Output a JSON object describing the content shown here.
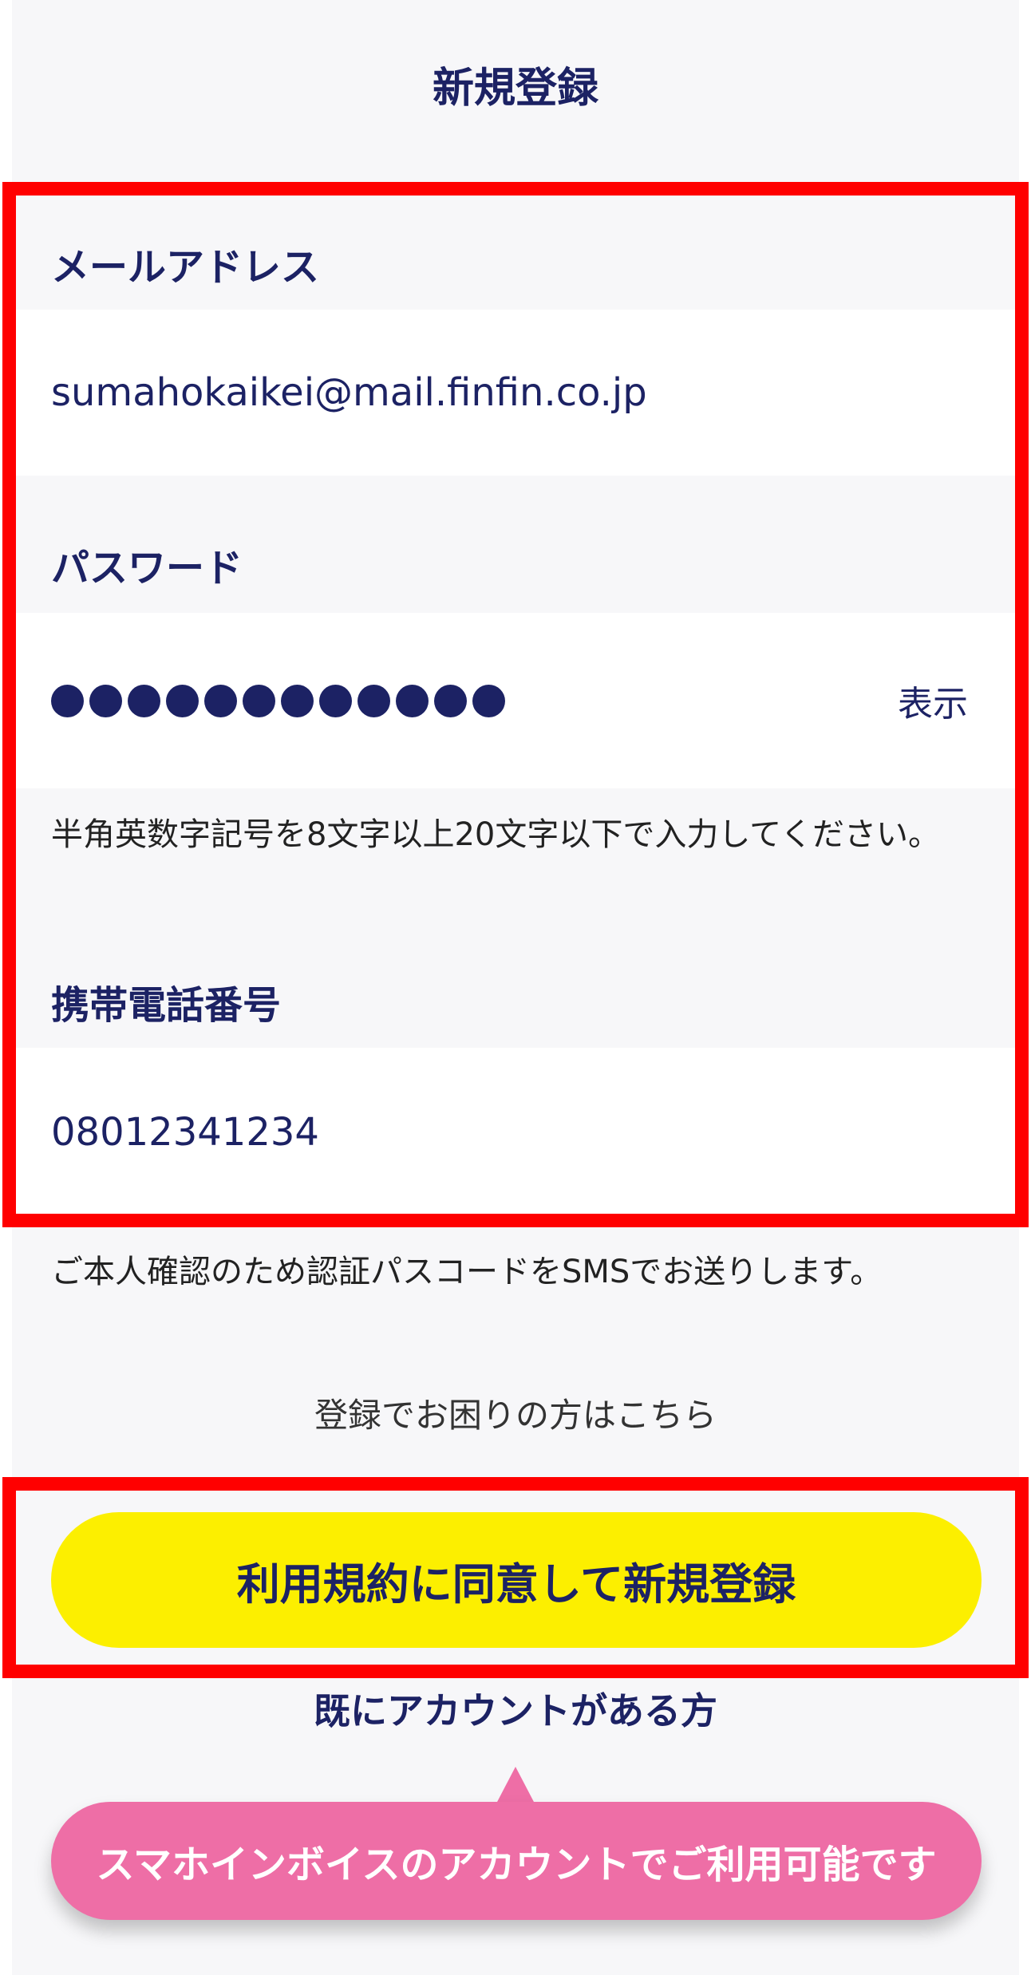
{
  "header": {
    "title": "新規登録"
  },
  "form": {
    "email": {
      "label": "メールアドレス",
      "value": "sumahokaikei@mail.finfin.co.jp"
    },
    "password": {
      "label": "パスワード",
      "masked_char_count": 12,
      "show_label": "表示",
      "hint": "半角英数字記号を8文字以上20文字以下で入力してください。"
    },
    "phone": {
      "label": "携帯電話番号",
      "value": "08012341234"
    },
    "sms_note": "ご本人確認のため認証パスコードをSMSでお送りします。"
  },
  "links": {
    "help": "登録でお困りの方はこちら",
    "existing_account": "既にアカウントがある方"
  },
  "buttons": {
    "register": "利用規約に同意して新規登録"
  },
  "tooltip": {
    "text": "スマホインボイスのアカウントでご利用可能です"
  },
  "colors": {
    "navy": "#1c2264",
    "yellow": "#fcef00",
    "pink": "#ee6ea6",
    "highlight_red": "#ff0000",
    "background": "#f7f7f9"
  }
}
